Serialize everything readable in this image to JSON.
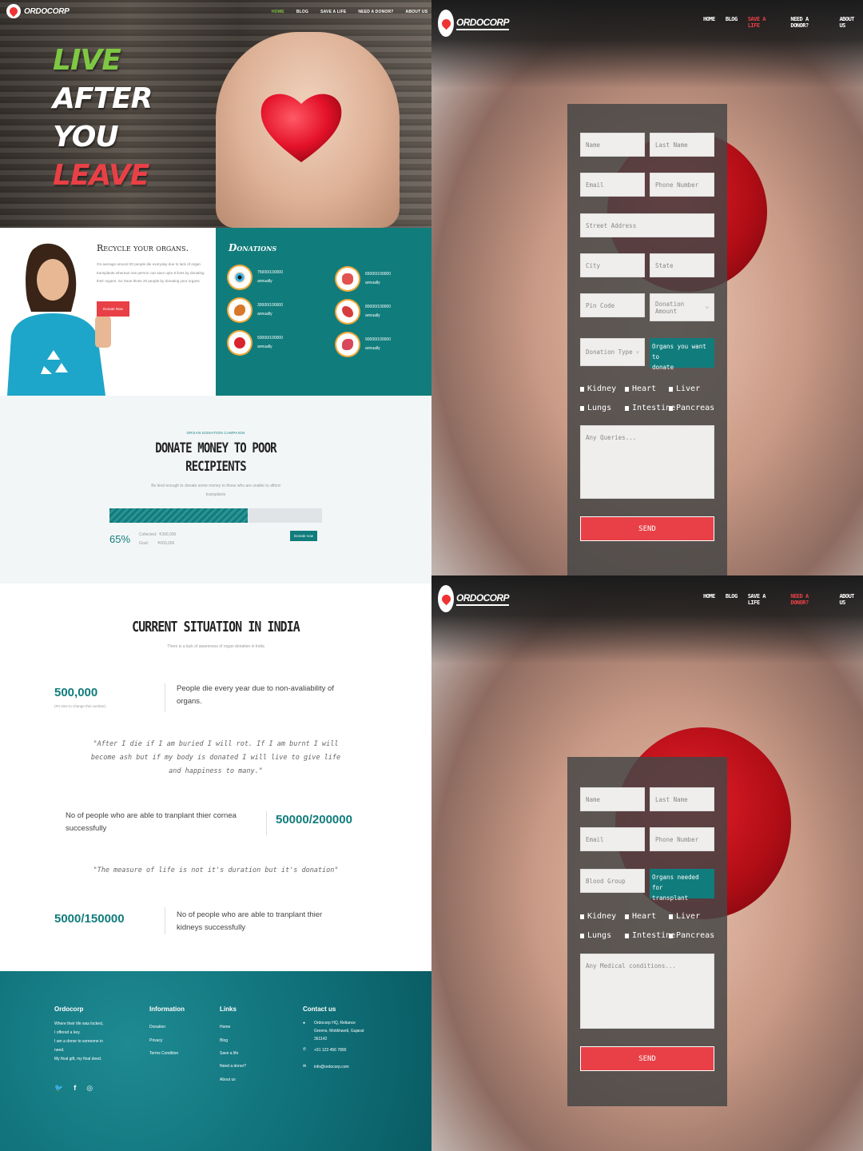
{
  "brand": "ORDOCORP",
  "nav": {
    "home": "HOME",
    "blog": "BLOG",
    "save": "SAVE A LIFE",
    "need": "NEED A DONOR?",
    "about": "ABOUT US"
  },
  "hero": {
    "line1": "LIVE",
    "line2": "AFTER",
    "line3": "YOU",
    "line4": "LEAVE",
    "color_green": "#7ec843",
    "color_red": "#e84046"
  },
  "recycle": {
    "title": "Recycle your organs.",
    "body": "On average around 20 people die everyday due to lack of organ transplants whereas one person can save upto 8 lives by donating their organs. So Save those 20 people by donating your organs",
    "button": "Donate Now"
  },
  "donations": {
    "title": "Donations",
    "items": [
      {
        "value": "75000/100000",
        "period": "annually",
        "icon": "eye-icon"
      },
      {
        "value": "65000/100000",
        "period": "annually",
        "icon": "lungs-icon"
      },
      {
        "value": "30000/100000",
        "period": "annually",
        "icon": "liver-icon"
      },
      {
        "value": "80000/100000",
        "period": "annually",
        "icon": "pancreas-icon"
      },
      {
        "value": "50000/100000",
        "period": "annually",
        "icon": "heart-icon"
      },
      {
        "value": "90000/100000",
        "period": "annually",
        "icon": "kidney-icon"
      }
    ]
  },
  "campaign": {
    "kicker": "ORGAN DONATION CAMPAIGN",
    "title1": "DONATE MONEY TO POOR",
    "title2": "RECIPIENTS",
    "desc1": "Be kind enough to donate some money to those who are unable to afford",
    "desc2": "transplants",
    "progress": 0.65,
    "percent": "65%",
    "collected_label": "Collected:",
    "collected": "₹390,000",
    "goal_label": "Goal:",
    "goal": "₹600,000",
    "button": "Donate now"
  },
  "situation": {
    "title": "CURRENT SITUATION IN INDIA",
    "subtitle": "There is a lack of awareness of organ donation in India",
    "stat1": "500,000",
    "stat1_note": "(It's time to change this number)",
    "stat1_text1": "People die every year due to non-avaliability of",
    "stat1_text2": "organs.",
    "quote1_l1": "\"After I die if I am buried I will rot. If I am burnt I will",
    "quote1_l2": "become ash but if my body is donated I will live to give life",
    "quote1_l3": "and happiness to many.\"",
    "stat2_text1": "No of people who are able to tranplant thier cornea",
    "stat2_text2": "successfully",
    "stat2": "50000/200000",
    "quote2": "\"The measure of life is not it's duration but it's donation\"",
    "stat3": "5000/150000",
    "stat3_text1": "No of people who are able to tranplant thier",
    "stat3_text2": "kidneys successfully"
  },
  "footer": {
    "col1_title": "Ordocorp",
    "col1_lines": [
      "Where their life was locked,",
      "I offered a key.",
      "I am a donor to someone in",
      "need.",
      "My final gift, my final deed."
    ],
    "col2_title": "Information",
    "col2_links": [
      "Donation",
      "Privacy",
      "Terms Condition"
    ],
    "col3_title": "Links",
    "col3_links": [
      "Home",
      "Blog",
      "Save a life",
      "Need a donor?",
      "About us"
    ],
    "col4_title": "Contact us",
    "address": [
      "Ordocorp HQ, Reliance",
      "Greens, Motikhavdi, Gujarat",
      "361142"
    ],
    "phone": "+91 123 456 7890",
    "email": "info@ordocorp.com"
  },
  "form1": {
    "name": "Name",
    "last": "Last Name",
    "email": "Email",
    "phone": "Phone Number",
    "street": "Street Address",
    "city": "City",
    "state": "State",
    "pin": "Pin Code",
    "amount": "Donation Amount",
    "type": "Donation Type",
    "organs_label1": "Organs you want to",
    "organs_label2": "donate",
    "organs": [
      "Kidney",
      "Heart",
      "Liver",
      "Lungs",
      "Intestine",
      "Pancreas"
    ],
    "queries": "Any Queries...",
    "send": "SEND"
  },
  "form2": {
    "name": "Name",
    "last": "Last Name",
    "email": "Email",
    "phone": "Phone Number",
    "blood": "Blood Group",
    "organs_label1": "Organs needed for",
    "organs_label2": "transplant",
    "organs": [
      "Kidney",
      "Heart",
      "Liver",
      "Lungs",
      "Intestine",
      "Pancreas"
    ],
    "conditions": "Any Medical conditions...",
    "send": "SEND"
  }
}
